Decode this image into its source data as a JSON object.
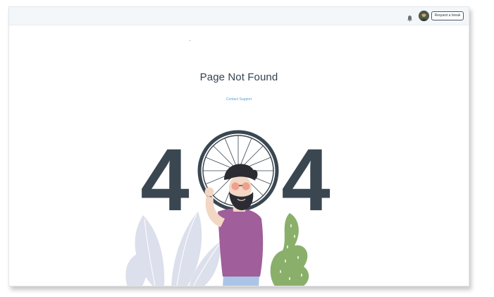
{
  "topbar": {
    "request_break_label": "Request a break",
    "notification_icon": "bell-icon",
    "avatar": "user-avatar"
  },
  "main": {
    "title": "Page Not Found",
    "support_link": "Contact Support",
    "error_code_left": "4",
    "error_code_right": "4"
  },
  "colors": {
    "digits": "#3a4751",
    "link": "#5a9fd6",
    "shirt": "#a05e9a",
    "cactus": "#8aaf6a",
    "leaves": "#dcdfec"
  }
}
